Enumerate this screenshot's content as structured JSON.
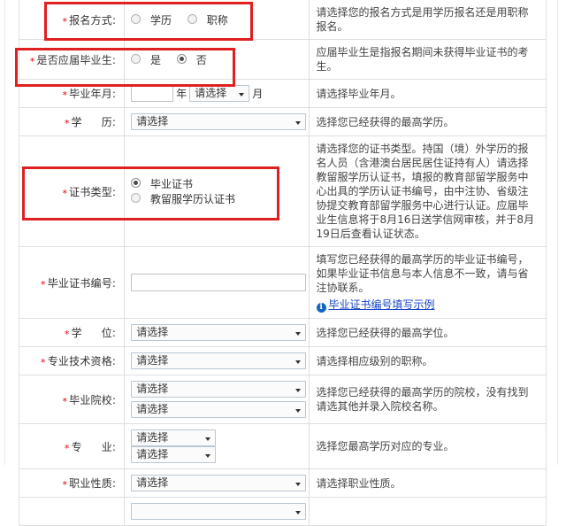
{
  "form": {
    "rows": [
      {
        "id": "signup-method",
        "label": "报名方式:",
        "required": "*",
        "control": "radio",
        "options": [
          {
            "text": "学历",
            "selected": false
          },
          {
            "text": "职称",
            "selected": false
          }
        ],
        "desc": "请选择您的报名方式是用学历报名还是用职称报名。"
      },
      {
        "id": "fresh-graduate",
        "label": "是否应届毕业生:",
        "required": "*",
        "control": "radio",
        "options": [
          {
            "text": "是",
            "selected": false
          },
          {
            "text": "否",
            "selected": true
          }
        ],
        "desc": "应届毕业生是指报名期间未获得毕业证书的考生。"
      },
      {
        "id": "graduation-date",
        "label": "毕业年月:",
        "required": "*",
        "control": "year-month",
        "year_value": "",
        "year_unit": "年",
        "month_value": "请选择",
        "month_unit": "月",
        "desc": "请选择毕业年月。"
      },
      {
        "id": "education",
        "label_spread": [
          "学",
          "历:"
        ],
        "label": "学    历:",
        "required": "*",
        "control": "select-wide",
        "value": "请选择",
        "desc": "选择您已经获得的最高学历。"
      },
      {
        "id": "certificate-type",
        "label": "证书类型:",
        "required": "*",
        "control": "radio",
        "options": [
          {
            "text": "毕业证书",
            "selected": true
          },
          {
            "text": "教留服学历认证书",
            "selected": false
          }
        ],
        "desc": "请选择您的证书类型。持国（境）外学历的报名人员（含港澳台居民居住证持有人）请选择教留服学历认证书，填报的教育部留学服务中心出具的学历认证书编号，由中注协、省级注协提交教育部留学服务中心进行认证。应届毕业生信息将于8月16日送学信网审核，并于8月19日后查看认证状态。"
      },
      {
        "id": "certificate-number",
        "label": "毕业证书编号:",
        "required": "*",
        "control": "text-wide",
        "value": "",
        "desc": "填写您已经获得的最高学历的毕业证书编号，如果毕业证书信息与本人信息不一致，请与省注协联系。",
        "link": "毕业证书编号填写示例",
        "link_icon": "info-icon"
      },
      {
        "id": "degree",
        "label_spread": [
          "学",
          "位:"
        ],
        "label": "学    位:",
        "required": "*",
        "control": "select-wide",
        "value": "请选择",
        "desc": "选择您已经获得的最高学位。"
      },
      {
        "id": "professional-title",
        "label": "专业技术资格:",
        "required": "*",
        "control": "select-wide",
        "value": "请选择",
        "desc": "请选择相应级别的职称。"
      },
      {
        "id": "graduation-school",
        "label": "毕业院校:",
        "required": "*",
        "control": "select-stacked",
        "value": "请选择",
        "value2": "请选择",
        "desc": "选择您已经获得的最高学历的院校，没有找到请选其他并录入院校名称。"
      },
      {
        "id": "major",
        "label_spread": [
          "专",
          "业:"
        ],
        "label": "专    业:",
        "required": "*",
        "control": "select-pair",
        "value": "请选择",
        "value2": "请选择",
        "desc": "选择您最高学历对应的专业。"
      },
      {
        "id": "occupation-nature",
        "label": "职业性质:",
        "required": "*",
        "control": "select-wide",
        "value": "请选择",
        "desc": "请选择职业性质。"
      }
    ],
    "partial_row": {
      "id": "next-row-partial",
      "label": "",
      "value": "",
      "desc": ""
    }
  },
  "annotations": {
    "signup_method": "red-highlight-box",
    "fresh_graduate": "red-highlight-box",
    "certificate_type": "red-highlight-box"
  },
  "colors": {
    "annotation": "#e02020",
    "required": "#e3000f",
    "link": "#1a44c8",
    "border": "#dfdfdf"
  }
}
